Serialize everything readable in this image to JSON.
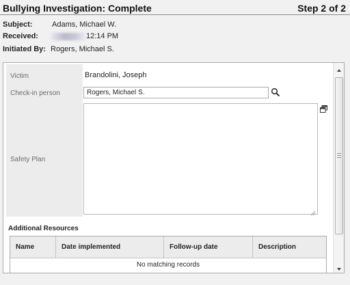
{
  "header": {
    "title": "Bullying Investigation: Complete",
    "step": "Step 2 of 2"
  },
  "meta": {
    "subject_label": "Subject:",
    "subject_value": "Adams, Michael W.",
    "received_label": "Received:",
    "received_value": "12:14 PM",
    "initiated_label": "Initiated By:",
    "initiated_value": "Rogers, Michael S."
  },
  "form": {
    "victim_label": "Victim",
    "victim_value": "Brandolini, Joseph",
    "checkin_label": "Check-in person",
    "checkin_value": "Rogers, Michael S.",
    "safety_plan_label": "Safety Plan",
    "safety_plan_value": ""
  },
  "resources": {
    "title": "Additional Resources",
    "columns": [
      "Name",
      "Date implemented",
      "Follow-up date",
      "Description"
    ],
    "empty_text": "No matching records"
  },
  "icons": {
    "search": "search-icon",
    "expand": "expand-window-icon",
    "resize": "resize-grip-icon",
    "scroll_up": "chevron-up-icon",
    "scroll_down": "chevron-down-icon"
  },
  "colors": {
    "label_column_bg": "#ececec",
    "panel_border": "#a9a9a9",
    "page_bg": "#f1f1f1"
  }
}
